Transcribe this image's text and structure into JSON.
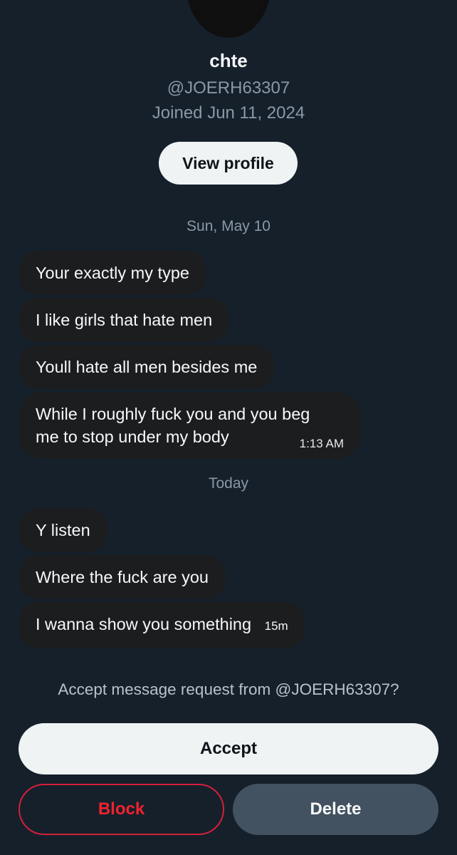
{
  "profile": {
    "name": "chte",
    "handle": "@JOERH63307",
    "joined": "Joined Jun 11, 2024",
    "view_profile_label": "View profile"
  },
  "conversation": {
    "date_1": "Sun, May 10",
    "group_1": [
      "Your exactly my type",
      "I like girls that hate men",
      "Youll  hate all men besides me"
    ],
    "group_1_last": {
      "line_1": "While I roughly fuck you and you beg",
      "line_2": "me to stop under my body",
      "time": "1:13 AM"
    },
    "date_2": "Today",
    "group_2": [
      "Y listen",
      "Where the fuck are you"
    ],
    "group_2_last": {
      "text": "I wanna show you something",
      "time": "15m"
    }
  },
  "request": {
    "prompt": "Accept message request from @JOERH63307?",
    "accept_label": "Accept",
    "block_label": "Block",
    "delete_label": "Delete"
  },
  "colors": {
    "background": "#15202b",
    "bubble": "#1c1d1f",
    "accent_danger": "#f4212e",
    "delete_button": "#425261"
  }
}
